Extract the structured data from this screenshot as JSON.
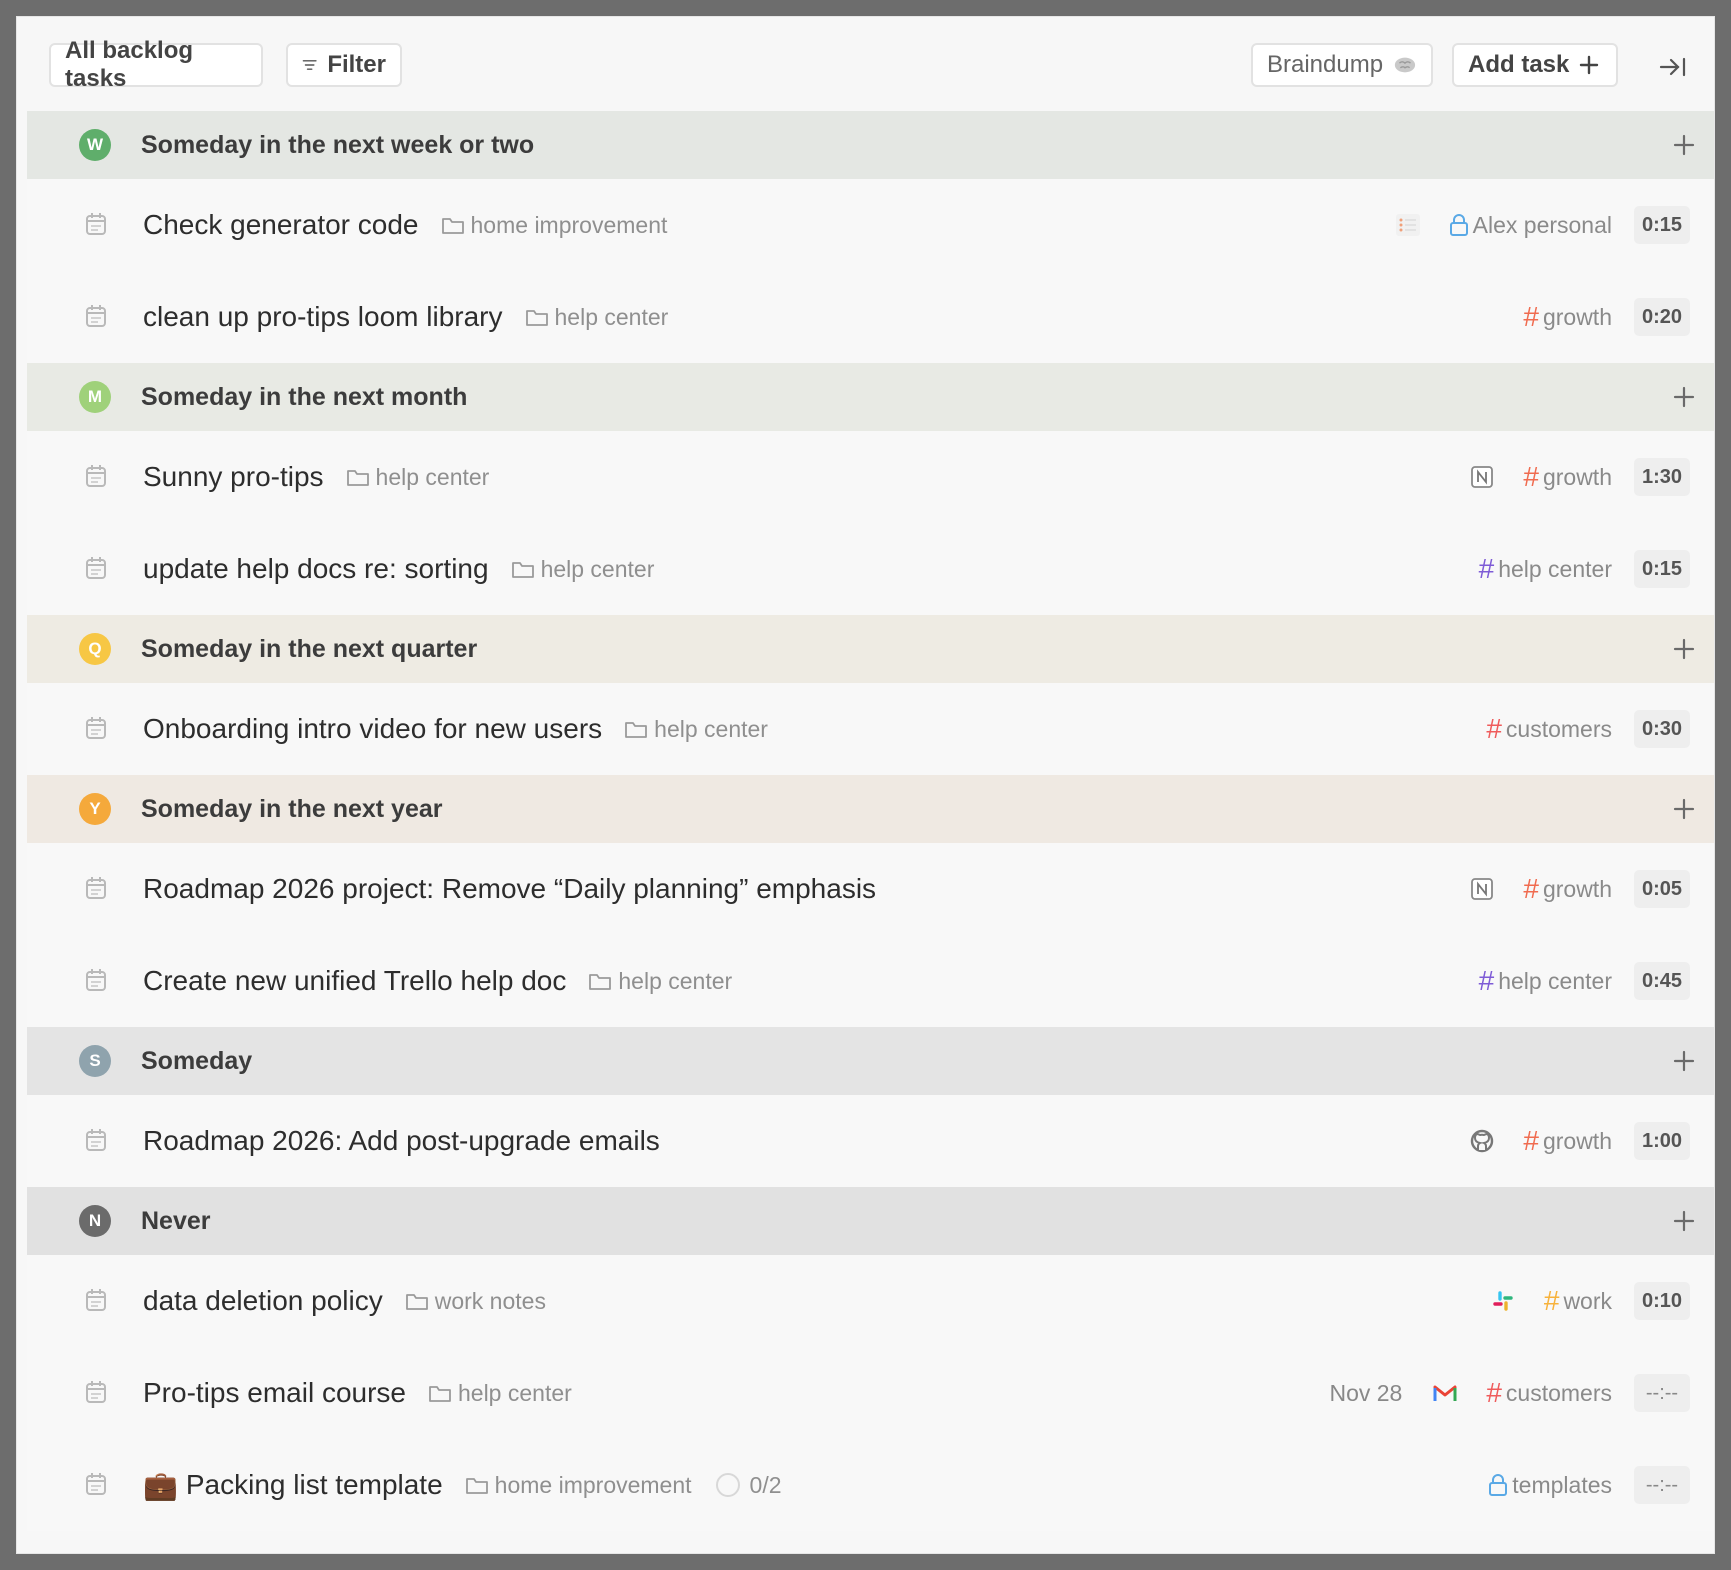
{
  "toolbar": {
    "all_backlog": "All backlog tasks",
    "filter": "Filter",
    "braindump": "Braindump",
    "add_task": "Add task"
  },
  "groups": [
    {
      "badge": "W",
      "label": "Someday in the next week or two",
      "color": "#5fae6b",
      "tasks": [
        {
          "title": "Check generator code",
          "folder": "home improvement",
          "integration": "list-icon",
          "tag": "Alex personal",
          "tag_type": "lock",
          "tag_color": "#5aa9e6",
          "duration": "0:15"
        },
        {
          "title": "clean up pro-tips loom library",
          "folder": "help center",
          "tag": "growth",
          "tag_type": "hash",
          "tag_color": "#f06b4f",
          "duration": "0:20"
        }
      ]
    },
    {
      "badge": "M",
      "label": "Someday in the next month",
      "color": "#9fd17a",
      "tasks": [
        {
          "title": "Sunny pro-tips",
          "folder": "help center",
          "integration": "notion-icon",
          "tag": "growth",
          "tag_type": "hash",
          "tag_color": "#f06b4f",
          "duration": "1:30"
        },
        {
          "title": "update help docs re: sorting",
          "folder": "help center",
          "tag": "help center",
          "tag_type": "hash",
          "tag_color": "#7e5bd6",
          "duration": "0:15"
        }
      ]
    },
    {
      "badge": "Q",
      "label": "Someday in the next quarter",
      "color": "#f7c744",
      "tasks": [
        {
          "title": "Onboarding intro video for new users",
          "folder": "help center",
          "tag": "customers",
          "tag_type": "hash",
          "tag_color": "#ef5b5b",
          "duration": "0:30"
        }
      ]
    },
    {
      "badge": "Y",
      "label": "Someday in the next year",
      "color": "#f5a93b",
      "tasks": [
        {
          "title": "Roadmap 2026 project: Remove “Daily planning” emphasis",
          "integration": "notion-icon",
          "tag": "growth",
          "tag_type": "hash",
          "tag_color": "#f06b4f",
          "duration": "0:05"
        },
        {
          "title": "Create new unified Trello help doc",
          "folder": "help center",
          "tag": "help center",
          "tag_type": "hash",
          "tag_color": "#7e5bd6",
          "duration": "0:45"
        }
      ]
    },
    {
      "badge": "S",
      "label": "Someday",
      "color": "#8fa3ad",
      "tasks": [
        {
          "title": "Roadmap 2026: Add post-upgrade emails",
          "integration": "github-icon",
          "tag": "growth",
          "tag_type": "hash",
          "tag_color": "#f06b4f",
          "duration": "1:00"
        }
      ]
    },
    {
      "badge": "N",
      "label": "Never",
      "color": "#6b6b6b",
      "tasks": [
        {
          "title": "data deletion policy",
          "folder": "work notes",
          "integration": "slack-icon",
          "tag": "work",
          "tag_type": "hash",
          "tag_color": "#f7b23b",
          "duration": "0:10"
        },
        {
          "title": "Pro-tips email course",
          "folder": "help center",
          "date": "Nov 28",
          "integration": "gmail-icon",
          "tag": "customers",
          "tag_type": "hash",
          "tag_color": "#ef5b5b",
          "duration": "--:--"
        },
        {
          "title": "Packing list template",
          "emoji": "💼",
          "folder": "home improvement",
          "subtasks": "0/2",
          "tag": "templates",
          "tag_type": "lock",
          "tag_color": "#5aa9e6",
          "duration": "--:--"
        }
      ]
    }
  ]
}
